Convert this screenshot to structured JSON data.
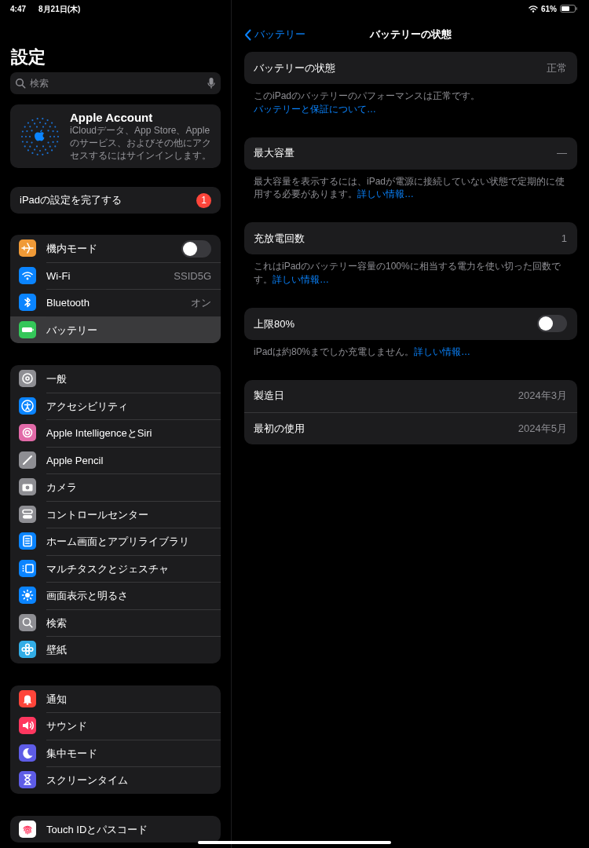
{
  "status_bar": {
    "time": "4:47",
    "date": "8月21日(木)",
    "battery_percent": "61%"
  },
  "sidebar": {
    "title": "設定",
    "search": {
      "placeholder": "検索"
    },
    "account": {
      "title": "Apple Account",
      "subtitle": "iCloudデータ、App Store、Appleのサービス、およびその他にアクセスするにはサインインします。"
    },
    "setup": {
      "label": "iPadの設定を完了する",
      "badge": "1"
    },
    "groups": [
      {
        "items": [
          {
            "label": "機内モード",
            "kind": "toggle",
            "on": false,
            "color": "#f09a37",
            "selected": false
          },
          {
            "label": "Wi-Fi",
            "kind": "value",
            "value": "SSID5G",
            "color": "#0a84ff",
            "selected": false
          },
          {
            "label": "Bluetooth",
            "kind": "value",
            "value": "オン",
            "color": "#0a84ff",
            "selected": false
          },
          {
            "label": "バッテリー",
            "kind": "link",
            "color": "#34c759",
            "selected": true
          }
        ]
      },
      {
        "items": [
          {
            "label": "一般",
            "kind": "link",
            "color": "#8e8e93",
            "selected": false
          },
          {
            "label": "アクセシビリティ",
            "kind": "link",
            "color": "#0a84ff",
            "selected": false
          },
          {
            "label": "Apple IntelligenceとSiri",
            "kind": "link",
            "color": "#e26aa8",
            "selected": false
          },
          {
            "label": "Apple Pencil",
            "kind": "link",
            "color": "#8e8e93",
            "selected": false
          },
          {
            "label": "カメラ",
            "kind": "link",
            "color": "#8e8e93",
            "selected": false
          },
          {
            "label": "コントロールセンター",
            "kind": "link",
            "color": "#8e8e93",
            "selected": false
          },
          {
            "label": "ホーム画面とアプリライブラリ",
            "kind": "link",
            "color": "#0a84ff",
            "selected": false
          },
          {
            "label": "マルチタスクとジェスチャ",
            "kind": "link",
            "color": "#0a84ff",
            "selected": false
          },
          {
            "label": "画面表示と明るさ",
            "kind": "link",
            "color": "#0a84ff",
            "selected": false
          },
          {
            "label": "検索",
            "kind": "link",
            "color": "#8e8e93",
            "selected": false
          },
          {
            "label": "壁紙",
            "kind": "link",
            "color": "#32ade6",
            "selected": false
          }
        ]
      },
      {
        "items": [
          {
            "label": "通知",
            "kind": "link",
            "color": "#ff453a",
            "selected": false
          },
          {
            "label": "サウンド",
            "kind": "link",
            "color": "#ff375f",
            "selected": false
          },
          {
            "label": "集中モード",
            "kind": "link",
            "color": "#5e5ce6",
            "selected": false
          },
          {
            "label": "スクリーンタイム",
            "kind": "link",
            "color": "#5e5ce6",
            "selected": false
          }
        ]
      },
      {
        "items": [
          {
            "label": "Touch IDとパスコード",
            "kind": "link",
            "color": "#ffffff",
            "selected": false
          }
        ]
      }
    ]
  },
  "detail": {
    "back": "バッテリー",
    "title": "バッテリーの状態",
    "sections": [
      {
        "rows": [
          {
            "label": "バッテリーの状態",
            "kind": "value",
            "value": "正常"
          }
        ],
        "footer": {
          "text": "このiPadのバッテリーのパフォーマンスは正常です。",
          "link": "バッテリーと保証について…"
        }
      },
      {
        "rows": [
          {
            "label": "最大容量",
            "kind": "value",
            "value": "—"
          }
        ],
        "footer": {
          "text": "最大容量を表示するには、iPadが電源に接続していない状態で定期的に使用する必要があります。",
          "link": "詳しい情報…"
        }
      },
      {
        "rows": [
          {
            "label": "充放電回数",
            "kind": "value",
            "value": "1"
          }
        ],
        "footer": {
          "text": "これはiPadのバッテリー容量の100%に相当する電力を使い切った回数です。",
          "link": "詳しい情報…"
        }
      },
      {
        "rows": [
          {
            "label": "上限80%",
            "kind": "toggle",
            "on": false
          }
        ],
        "footer": {
          "text": "iPadは約80%までしか充電しません。",
          "link": "詳しい情報…"
        }
      },
      {
        "rows": [
          {
            "label": "製造日",
            "kind": "value",
            "value": "2024年3月"
          },
          {
            "label": "最初の使用",
            "kind": "value",
            "value": "2024年5月"
          }
        ]
      }
    ]
  }
}
